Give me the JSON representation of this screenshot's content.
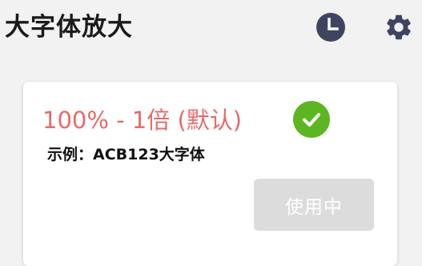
{
  "header": {
    "title": "大字体放大",
    "history_icon": "history-clock-icon",
    "settings_icon": "gear-icon"
  },
  "card": {
    "title": "100% - 1倍 (默认)",
    "title_color": "#e86a6a",
    "status_icon": "check-circle-icon",
    "status_color": "#5cb521",
    "sample_label": "示例：",
    "sample_text": "ACB123大字体",
    "button_label": "使用中",
    "button_color": "#dcdcdc"
  }
}
